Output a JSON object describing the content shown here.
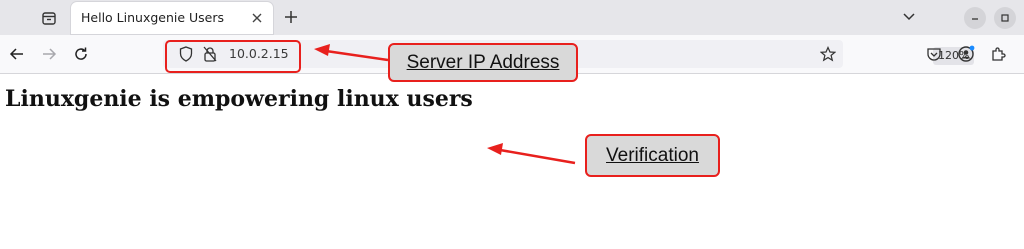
{
  "browser": {
    "tab": {
      "title": "Hello Linuxgenie Users"
    },
    "address_bar": {
      "url": "10.0.2.15",
      "zoom": "120%"
    }
  },
  "page": {
    "heading": "Linuxgenie is empowering linux users"
  },
  "annotations": {
    "ip_label": "Server IP Address",
    "verification_label": "Verification",
    "color": "#e8201d"
  },
  "icons": {
    "tab_overview": "tab-overview-icon",
    "close": "close-icon",
    "new_tab": "plus-icon",
    "list_tabs": "chevron-down-icon",
    "minimize": "minimize-icon",
    "maximize": "maximize-icon",
    "back": "back-arrow-icon",
    "forward": "forward-arrow-icon",
    "reload": "reload-icon",
    "shield": "shield-icon",
    "insecure_lock": "insecure-lock-icon",
    "bookmark": "star-icon",
    "pocket": "pocket-icon",
    "account": "account-icon",
    "extensions": "extensions-icon"
  }
}
